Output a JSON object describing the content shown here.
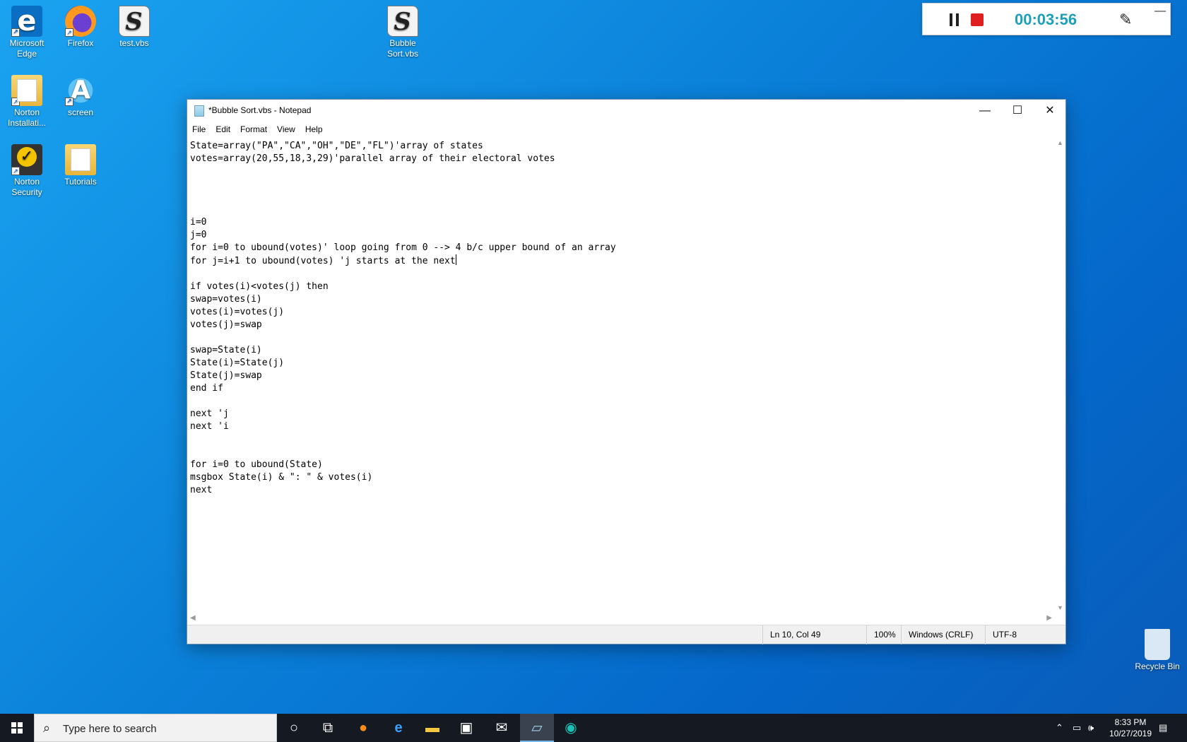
{
  "desktop": {
    "icons": {
      "edge": "Microsoft Edge",
      "firefox": "Firefox",
      "test_vbs": "test.vbs",
      "bubble_sort": "Bubble Sort.vbs",
      "norton_install": "Norton Installati...",
      "screen": "screen",
      "norton_security": "Norton Security",
      "tutorials": "Tutorials",
      "recycle_bin": "Recycle Bin"
    }
  },
  "recorder": {
    "elapsed": "00:03:56"
  },
  "notepad": {
    "title": "*Bubble Sort.vbs - Notepad",
    "menu": [
      "File",
      "Edit",
      "Format",
      "View",
      "Help"
    ],
    "text_before_caret": "State=array(\"PA\",\"CA\",\"OH\",\"DE\",\"FL\")'array of states\nvotes=array(20,55,18,3,29)'parallel array of their electoral votes\n\n\n\n\ni=0\nj=0\nfor i=0 to ubound(votes)' loop going from 0 --> 4 b/c upper bound of an array\nfor j=i+1 to ubound(votes) 'j starts at the next",
    "text_after_caret": "\n\nif votes(i)<votes(j) then\nswap=votes(i)\nvotes(i)=votes(j)\nvotes(j)=swap\n\nswap=State(i)\nState(i)=State(j)\nState(j)=swap\nend if\n\nnext 'j\nnext 'i\n\n\nfor i=0 to ubound(State)\nmsgbox State(i) & \": \" & votes(i)\nnext",
    "status": {
      "position": "Ln 10, Col 49",
      "zoom": "100%",
      "line_ending": "Windows (CRLF)",
      "encoding": "UTF-8"
    }
  },
  "taskbar": {
    "search_placeholder": "Type here to search",
    "time": "8:33 PM",
    "date": "10/27/2019"
  }
}
